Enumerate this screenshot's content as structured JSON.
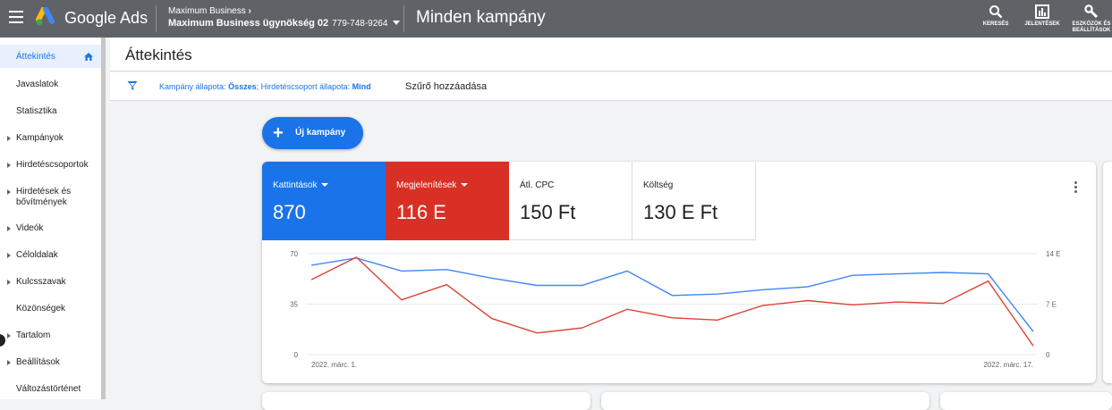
{
  "topbar": {
    "app_name": "Google Ads",
    "account_parent": "Maximum Business",
    "account_name": "Maximum Business ügynökség 02",
    "account_id": "779-748-9264",
    "page_heading": "Minden kampány",
    "tools": [
      {
        "label": "KERESÉS",
        "icon": "search-icon"
      },
      {
        "label": "JELENTÉSEK",
        "icon": "reports-icon"
      },
      {
        "label": "ESZKÖZÖK ÉS BEÁLLÍTÁSOK",
        "icon": "wrench-icon"
      }
    ]
  },
  "sidebar": {
    "items": [
      {
        "label": "Áttekintés",
        "active": true,
        "expandable": false
      },
      {
        "label": "Javaslatok",
        "expandable": false
      },
      {
        "label": "Statisztika",
        "expandable": false
      },
      {
        "label": "Kampányok",
        "expandable": true
      },
      {
        "label": "Hirdetéscsoportok",
        "expandable": true
      },
      {
        "label": "Hirdetések és bővítmények",
        "expandable": true
      },
      {
        "label": "Videók",
        "expandable": true
      },
      {
        "label": "Céloldalak",
        "expandable": true
      },
      {
        "label": "Kulcsszavak",
        "expandable": true
      },
      {
        "label": "Közönségek",
        "expandable": false
      },
      {
        "label": "Tartalom",
        "expandable": true
      },
      {
        "label": "Beállítások",
        "expandable": true
      },
      {
        "label": "Változástörténet",
        "expandable": false
      }
    ]
  },
  "main": {
    "title": "Áttekintés",
    "filter": {
      "prefix1": "Kampány állapota: ",
      "value1": "Összes",
      "prefix2": "; Hirdetéscsoport állapota: ",
      "value2": "Mind",
      "add_filter": "Szűrő hozzáadása"
    },
    "new_campaign_label": "Új kampány",
    "metrics": [
      {
        "label": "Kattintások",
        "value": "870",
        "color": "#1a73e8",
        "dropdown": true
      },
      {
        "label": "Megjelenítések",
        "value": "116 E",
        "color": "#d93025",
        "dropdown": true
      },
      {
        "label": "Átl. CPC",
        "value": "150 Ft"
      },
      {
        "label": "Költség",
        "value": "130 E Ft"
      }
    ]
  },
  "chart_data": {
    "type": "line",
    "x_start_label": "2022. márc. 1.",
    "x_end_label": "2022. márc. 17.",
    "x": [
      1,
      2,
      3,
      4,
      5,
      6,
      7,
      8,
      9,
      10,
      11,
      12,
      13,
      14,
      15,
      16,
      17
    ],
    "left_axis": {
      "ticks": [
        "70",
        "35",
        "0"
      ],
      "ylim": [
        0,
        70
      ]
    },
    "right_axis": {
      "ticks": [
        "14 E",
        "7 E",
        "0"
      ],
      "ylim": [
        0,
        14000
      ]
    },
    "series": [
      {
        "color": "#4285f4",
        "axis": "left",
        "values": [
          62,
          67,
          58,
          59,
          53,
          48,
          48,
          58,
          41,
          42,
          45,
          47,
          55,
          56,
          57,
          56,
          16
        ]
      },
      {
        "color": "#db4437",
        "axis": "right",
        "values": [
          10400,
          13500,
          7600,
          9700,
          5000,
          3000,
          3700,
          6300,
          5100,
          4800,
          6800,
          7500,
          6900,
          7300,
          7100,
          10200,
          1200
        ]
      }
    ],
    "grid": true
  }
}
